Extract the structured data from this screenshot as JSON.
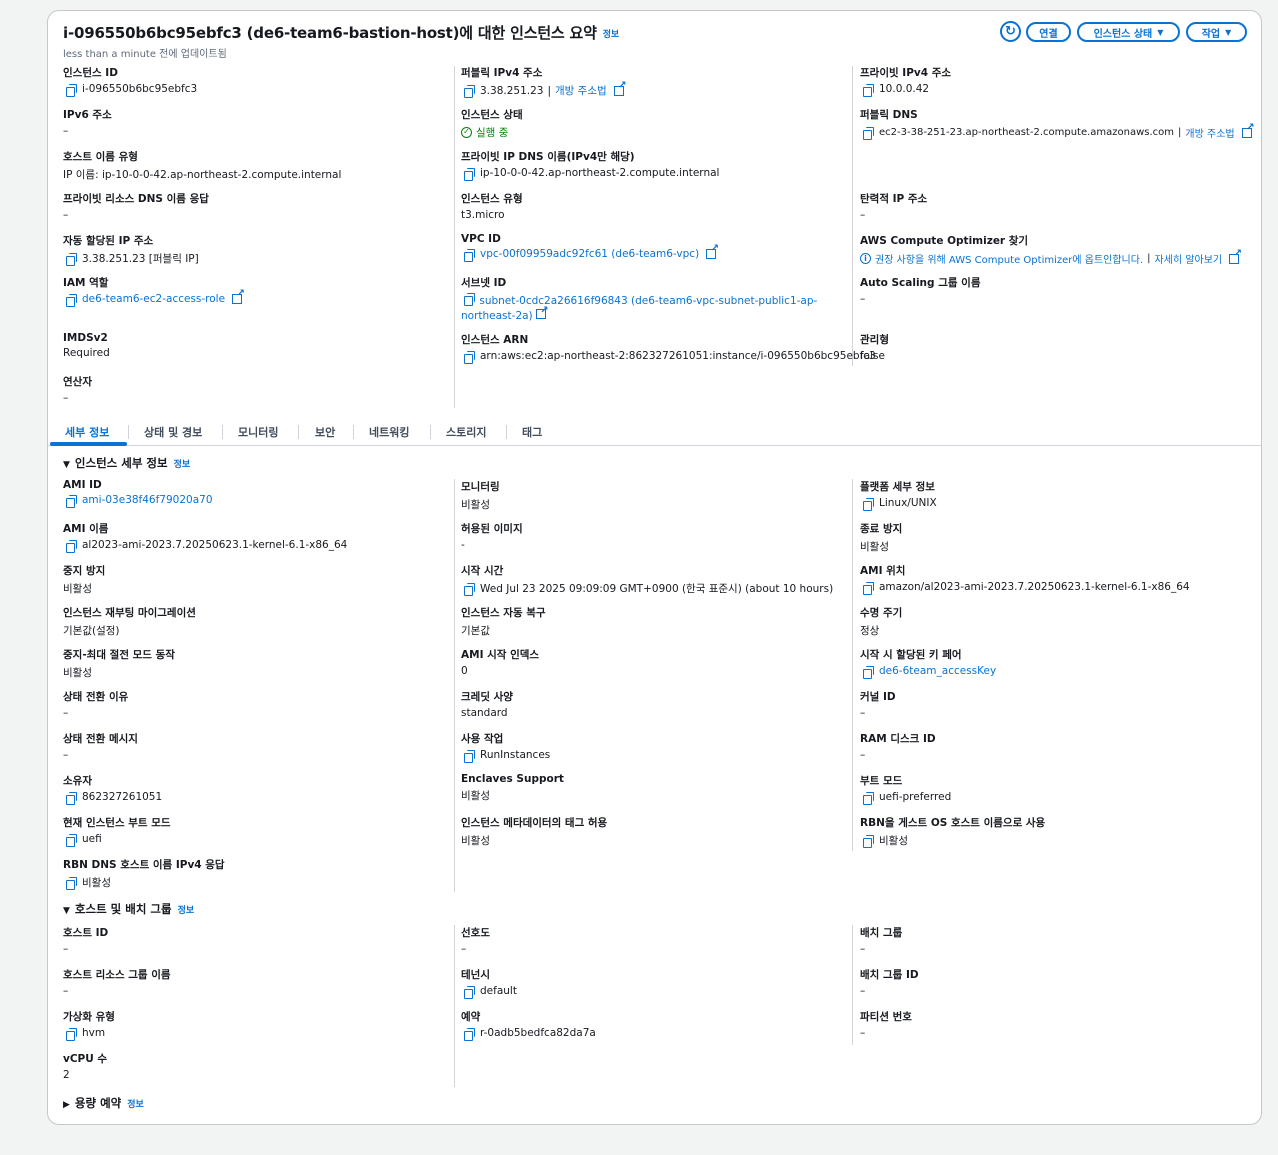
{
  "header": {
    "title": "i-096550b6bc95ebfc3 (de6-team6-bastion-host)에 대한 인스턴스 요약",
    "info": "정보",
    "subtitle": "less than a minute 전에 업데이트됨",
    "refresh_icon": "refresh-icon",
    "connect_label": "연결",
    "state_label": "인스턴스 상태",
    "actions_label": "작업"
  },
  "summary": {
    "instance_id": {
      "label": "인스턴스 ID",
      "value": "i-096550b6bc95ebfc3"
    },
    "public_ipv4": {
      "label": "퍼블릭 IPv4 주소",
      "value": "3.38.251.23",
      "link": "개방 주소법"
    },
    "private_ipv4": {
      "label": "프라이빗 IPv4 주소",
      "value": "10.0.0.42"
    },
    "ipv6": {
      "label": "IPv6 주소",
      "value": "–"
    },
    "instance_state": {
      "label": "인스턴스 상태",
      "value": "실행 중"
    },
    "public_dns": {
      "label": "퍼블릭 DNS",
      "value": "ec2-3-38-251-23.ap-northeast-2.compute.amazonaws.com",
      "link": "개방 주소법"
    },
    "hostname_type": {
      "label": "호스트 이름 유형",
      "value": "IP 이름: ip-10-0-0-42.ap-northeast-2.compute.internal"
    },
    "private_ip_dns": {
      "label": "프라이빗 IP DNS 이름(IPv4만 해당)",
      "value": "ip-10-0-0-42.ap-northeast-2.compute.internal"
    },
    "resource_dns": {
      "label": "프라이빗 리소스 DNS 이름 응답",
      "value": "–"
    },
    "instance_type": {
      "label": "인스턴스 유형",
      "value": "t3.micro"
    },
    "elastic_ip": {
      "label": "탄력적 IP 주소",
      "value": "–"
    },
    "auto_ip": {
      "label": "자동 할당된 IP 주소",
      "value": "3.38.251.23 [퍼블릭 IP]"
    },
    "vpc_id": {
      "label": "VPC ID",
      "value": "vpc-00f09959adc92fc61 (de6-team6-vpc)"
    },
    "compute_optimizer": {
      "label": "AWS Compute Optimizer 찾기",
      "value": "권장 사항을 위해 AWS Compute Optimizer에 옵트인합니다.",
      "sep": "|",
      "link": "자세히 알아보기"
    },
    "iam_role": {
      "label": "IAM 역할",
      "value": "de6-team6-ec2-access-role"
    },
    "subnet_id": {
      "label": "서브넷 ID",
      "value": "subnet-0cdc2a26616f96843 (de6-team6-vpc-subnet-public1-ap-northeast-2a)"
    },
    "asg_name": {
      "label": "Auto Scaling 그룹 이름",
      "value": "–"
    },
    "imdsv2": {
      "label": "IMDSv2",
      "value": "Required"
    },
    "instance_arn": {
      "label": "인스턴스 ARN",
      "value": "arn:aws:ec2:ap-northeast-2:862327261051:instance/i-096550b6bc95ebfc3"
    },
    "managed": {
      "label": "관리형",
      "value": "false"
    },
    "operator": {
      "label": "연산자",
      "value": "–"
    }
  },
  "tabs": [
    "세부 정보",
    "상태 및 경보",
    "모니터링",
    "보안",
    "네트워킹",
    "스토리지",
    "태그"
  ],
  "details": {
    "heading": "인스턴스 세부 정보",
    "info": "정보",
    "col1": [
      {
        "label": "AMI ID",
        "value": "ami-03e38f46f79020a70"
      },
      {
        "label": "AMI 이름",
        "value": "al2023-ami-2023.7.20250623.1-kernel-6.1-x86_64"
      },
      {
        "label": "중지 방지",
        "value": "비활성"
      },
      {
        "label": "인스턴스 재부팅 마이그레이션",
        "value": "기본값(설정)"
      },
      {
        "label": "중지-최대 절전 모드 동작",
        "value": "비활성"
      },
      {
        "label": "상태 전환 이유",
        "value": "–"
      },
      {
        "label": "상태 전환 메시지",
        "value": "–"
      },
      {
        "label": "소유자",
        "value": "862327261051"
      },
      {
        "label": "현재 인스턴스 부트 모드",
        "value": "uefi"
      },
      {
        "label": "RBN DNS 호스트 이름 IPv4 응답",
        "value": "비활성"
      }
    ],
    "col2": [
      {
        "label": "모니터링",
        "value": "비활성"
      },
      {
        "label": "허용된 이미지",
        "value": "-"
      },
      {
        "label": "시작 시간",
        "value": "Wed Jul 23 2025 09:09:09 GMT+0900 (한국 표준시) (about 10 hours)"
      },
      {
        "label": "인스턴스 자동 복구",
        "value": "기본값"
      },
      {
        "label": "AMI 시작 인덱스",
        "value": "0"
      },
      {
        "label": "크레딧 사양",
        "value": "standard"
      },
      {
        "label": "사용 작업",
        "value": "RunInstances"
      },
      {
        "label": "Enclaves Support",
        "value": "비활성"
      },
      {
        "label": "인스턴스 메타데이터의 태그 허용",
        "value": "비활성"
      }
    ],
    "col3": [
      {
        "label": "플랫폼 세부 정보",
        "value": "Linux/UNIX"
      },
      {
        "label": "종료 방지",
        "value": "비활성"
      },
      {
        "label": "AMI 위치",
        "value": "amazon/al2023-ami-2023.7.20250623.1-kernel-6.1-x86_64"
      },
      {
        "label": "수명 주기",
        "value": "정상"
      },
      {
        "label": "시작 시 할당된 키 페어",
        "value": "de6-6team_accessKey"
      },
      {
        "label": "커널 ID",
        "value": "–"
      },
      {
        "label": "RAM 디스크 ID",
        "value": "–"
      },
      {
        "label": "부트 모드",
        "value": "uefi-preferred"
      },
      {
        "label": "RBN을 게스트 OS 호스트 이름으로 사용",
        "value": "비활성"
      }
    ]
  },
  "host": {
    "heading": "호스트 및 배치 그룹",
    "info": "정보",
    "col1": [
      {
        "label": "호스트 ID",
        "value": "–"
      },
      {
        "label": "호스트 리소스 그룹 이름",
        "value": "–"
      },
      {
        "label": "가상화 유형",
        "value": "hvm"
      },
      {
        "label": "vCPU 수",
        "value": "2"
      }
    ],
    "col2": [
      {
        "label": "선호도",
        "value": "–"
      },
      {
        "label": "테넌시",
        "value": "default"
      },
      {
        "label": "예약",
        "value": "r-0adb5bedfca82da7a"
      }
    ],
    "col3": [
      {
        "label": "배치 그룹",
        "value": "–"
      },
      {
        "label": "배치 그룹 ID",
        "value": "–"
      },
      {
        "label": "파티션 번호",
        "value": "–"
      }
    ]
  },
  "capacity": {
    "heading": "용량 예약",
    "info": "정보"
  }
}
